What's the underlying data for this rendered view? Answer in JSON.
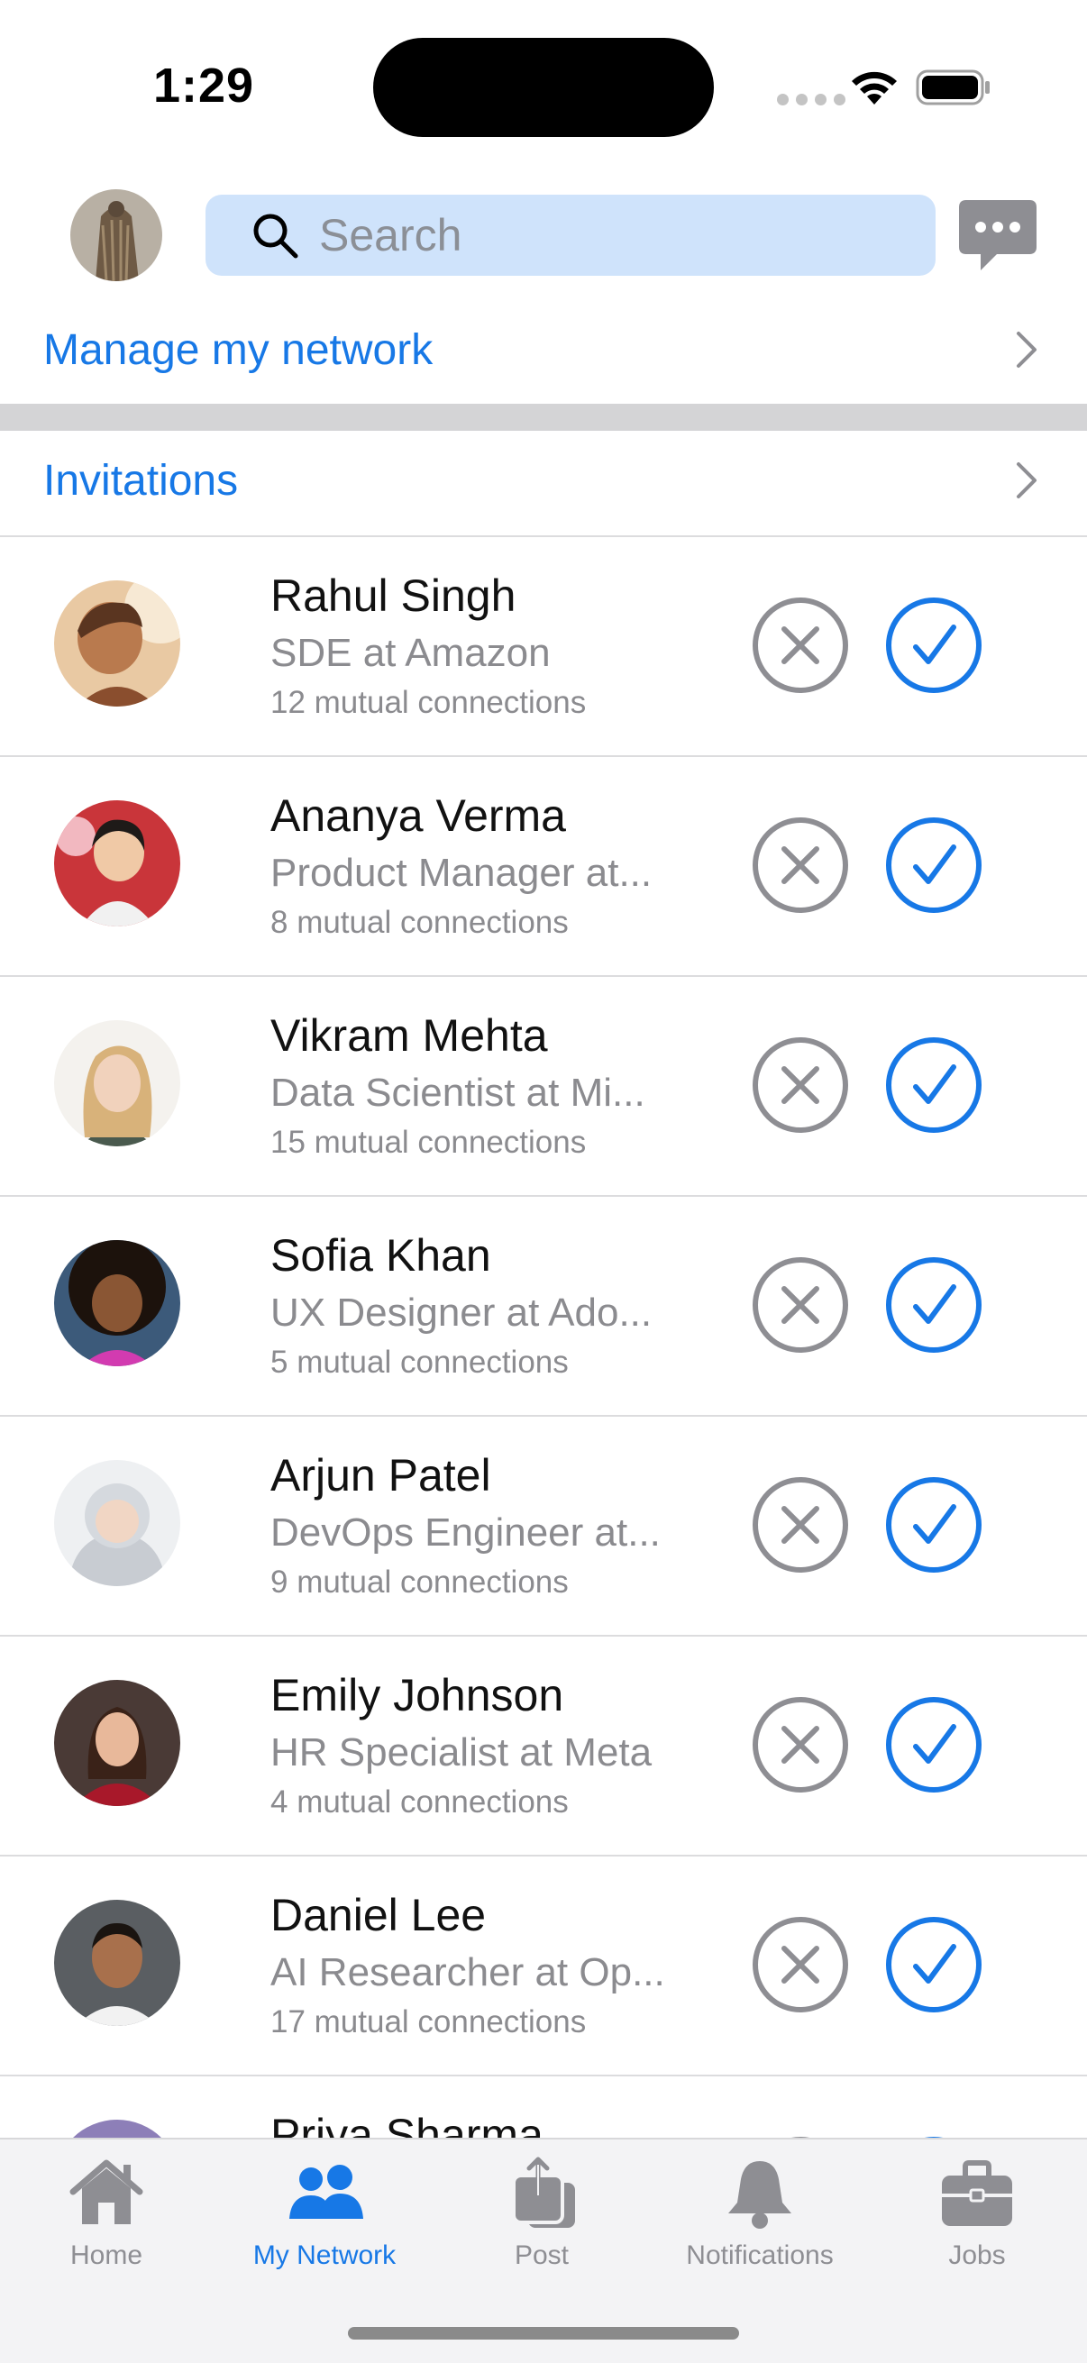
{
  "status_bar": {
    "time": "1:29"
  },
  "header": {
    "search_placeholder": "Search"
  },
  "sections": {
    "manage": "Manage my network",
    "invitations": "Invitations"
  },
  "invitations": [
    {
      "name": "Rahul Singh",
      "title": "SDE at Amazon",
      "mutual": "12 mutual connections"
    },
    {
      "name": "Ananya Verma",
      "title": "Product Manager at...",
      "mutual": "8 mutual connections"
    },
    {
      "name": "Vikram Mehta",
      "title": "Data Scientist at Mi...",
      "mutual": "15 mutual connections"
    },
    {
      "name": "Sofia Khan",
      "title": "UX Designer at Ado...",
      "mutual": "5 mutual connections"
    },
    {
      "name": "Arjun Patel",
      "title": "DevOps Engineer at...",
      "mutual": "9 mutual connections"
    },
    {
      "name": "Emily Johnson",
      "title": "HR Specialist at Meta",
      "mutual": "4 mutual connections"
    },
    {
      "name": "Daniel Lee",
      "title": "AI Researcher at Op...",
      "mutual": "17 mutual connections"
    },
    {
      "name": "Priya Sharma",
      "title": "",
      "mutual": ""
    }
  ],
  "tabs": [
    {
      "label": "Home",
      "icon": "home-icon"
    },
    {
      "label": "My Network",
      "icon": "network-icon"
    },
    {
      "label": "Post",
      "icon": "post-icon"
    },
    {
      "label": "Notifications",
      "icon": "bell-icon"
    },
    {
      "label": "Jobs",
      "icon": "briefcase-icon"
    }
  ],
  "colors": {
    "accent": "#1778e6",
    "search_bg": "#cfe3fb",
    "ignore": "#8e8e93",
    "tab_inactive": "#8e8e93"
  }
}
